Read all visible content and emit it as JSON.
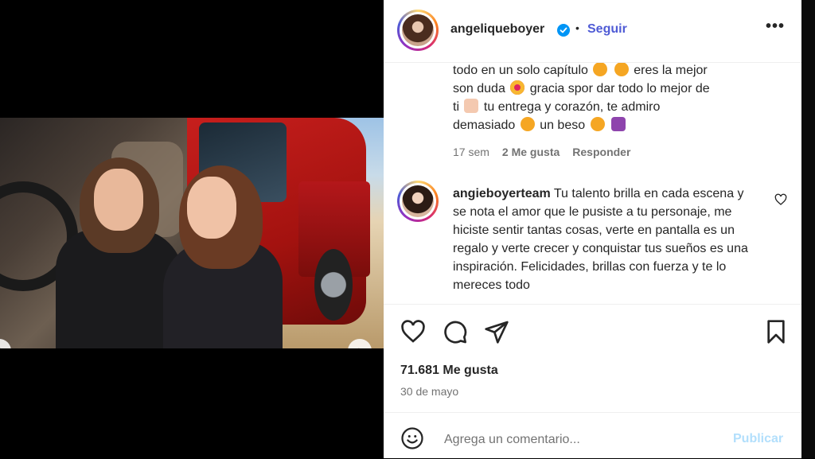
{
  "post": {
    "username": "angeliqueboyer",
    "bullet": "•",
    "follow_label": "Seguir",
    "more_label": "•••",
    "carousel": {
      "dot_count": 19,
      "active_index": 8
    }
  },
  "comments": [
    {
      "text_line1": "todo en un solo capítulo",
      "text_line1b": "eres la mejor",
      "text_line2": "son duda",
      "text_line2b": "gracia spor dar todo lo mejor de",
      "text_line3": "ti",
      "text_line3b": "tu entrega y corazón, te admiro",
      "text_line4": "demasiado",
      "text_line4b": "un beso",
      "time": "17 sem",
      "likes": "2 Me gusta",
      "reply": "Responder"
    },
    {
      "user": "angieboyerteam",
      "text": "Tu talento brilla en cada escena y se nota el amor que le pusiste a tu personaje, me hiciste sentir tantas cosas, verte en pantalla es un regalo y verte crecer y conquistar tus sueños es una inspiración. Felicidades, brillas con fuerza y te lo mereces todo"
    }
  ],
  "stats": {
    "likes": "71.681 Me gusta",
    "date": "30 de mayo"
  },
  "composer": {
    "placeholder": "Agrega un comentario...",
    "publish": "Publicar"
  },
  "colors": {
    "accent": "#4f5bd5",
    "publish_disabled": "#b2dffc",
    "verified": "#0095f6"
  }
}
